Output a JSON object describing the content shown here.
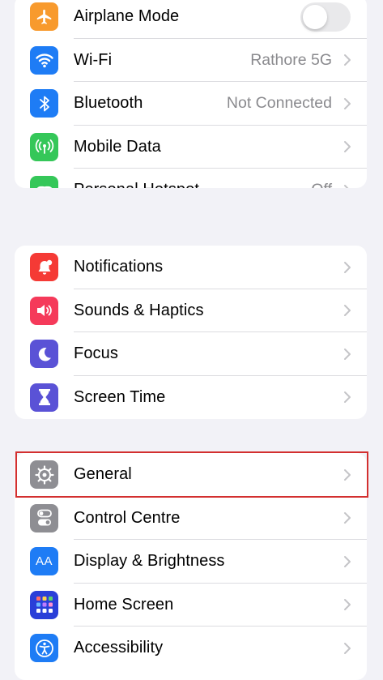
{
  "colors": {
    "background": "#f2f2f7",
    "value_text": "#8a8a8e",
    "highlight": "#d32f2f"
  },
  "groups": [
    {
      "items": [
        {
          "label": "Airplane Mode",
          "icon": "airplane-icon",
          "color": "#f89a2d",
          "toggle": "off"
        },
        {
          "label": "Wi-Fi",
          "value": "Rathore 5G",
          "icon": "wifi-icon",
          "color": "#1e7cf5"
        },
        {
          "label": "Bluetooth",
          "value": "Not Connected",
          "icon": "bluetooth-icon",
          "color": "#1e7cf5"
        },
        {
          "label": "Mobile Data",
          "icon": "antenna-icon",
          "color": "#35c759"
        },
        {
          "label": "Personal Hotspot",
          "value": "Off",
          "icon": "hotspot-icon",
          "color": "#35c759"
        }
      ]
    },
    {
      "items": [
        {
          "label": "Notifications",
          "icon": "bell-icon",
          "color": "#f53a35"
        },
        {
          "label": "Sounds & Haptics",
          "icon": "speaker-icon",
          "color": "#f53a5a"
        },
        {
          "label": "Focus",
          "icon": "moon-icon",
          "color": "#5a52d6"
        },
        {
          "label": "Screen Time",
          "icon": "hourglass-icon",
          "color": "#5a52d6"
        }
      ]
    },
    {
      "items": [
        {
          "label": "General",
          "icon": "gear-icon",
          "color": "#8e8e93",
          "highlighted": true
        },
        {
          "label": "Control Centre",
          "icon": "switches-icon",
          "color": "#8e8e93"
        },
        {
          "label": "Display & Brightness",
          "icon": "text-size-icon",
          "color": "#1e7cf5",
          "glyph": "AA"
        },
        {
          "label": "Home Screen",
          "icon": "app-grid-icon",
          "color": "#2a3fd8"
        },
        {
          "label": "Accessibility",
          "icon": "accessibility-icon",
          "color": "#1e7cf5"
        }
      ]
    }
  ]
}
